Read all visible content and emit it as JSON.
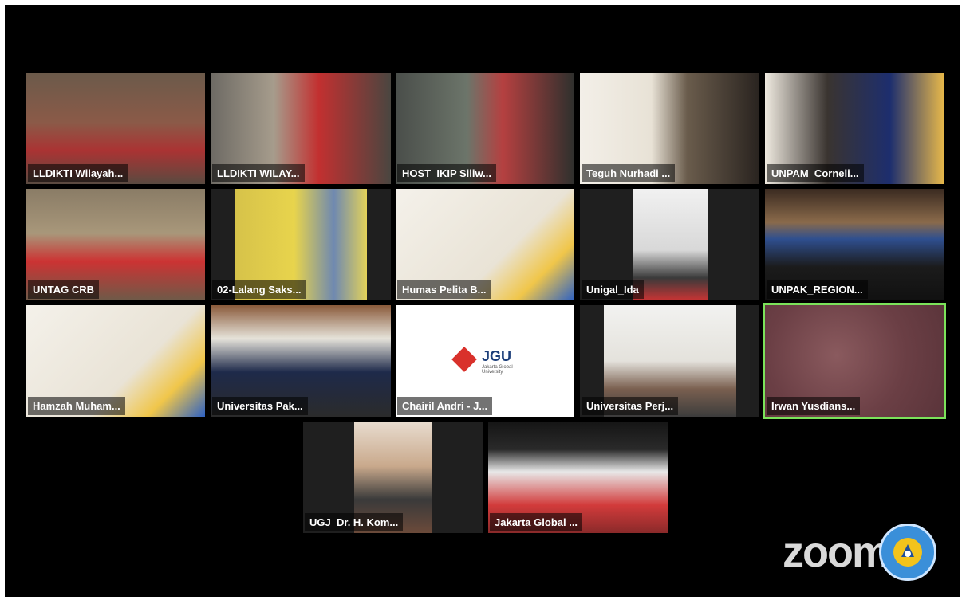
{
  "participants": [
    {
      "name": "LLDIKTI Wilayah..."
    },
    {
      "name": "LLDIKTI WILAY..."
    },
    {
      "name": "HOST_IKIP Siliw..."
    },
    {
      "name": "Teguh Nurhadi ..."
    },
    {
      "name": "UNPAM_Corneli..."
    },
    {
      "name": "UNTAG CRB"
    },
    {
      "name": "02-Lalang Saks..."
    },
    {
      "name": "Humas Pelita B..."
    },
    {
      "name": "Unigal_Ida"
    },
    {
      "name": "UNPAK_REGION..."
    },
    {
      "name": "Hamzah Muham..."
    },
    {
      "name": "Universitas Pak..."
    },
    {
      "name": "Chairil Andri - J..."
    },
    {
      "name": "Universitas Perj..."
    },
    {
      "name": "Irwan Yusdians..."
    },
    {
      "name": "UGJ_Dr. H. Kom..."
    },
    {
      "name": "Jakarta Global ..."
    }
  ],
  "branding": {
    "zoom_watermark": "zoom",
    "lldikti_logo": "LLDIKTI",
    "jgu_logo": "JGU",
    "jgu_sub": "Jakarta Global University",
    "active_color": "#7be35a"
  }
}
